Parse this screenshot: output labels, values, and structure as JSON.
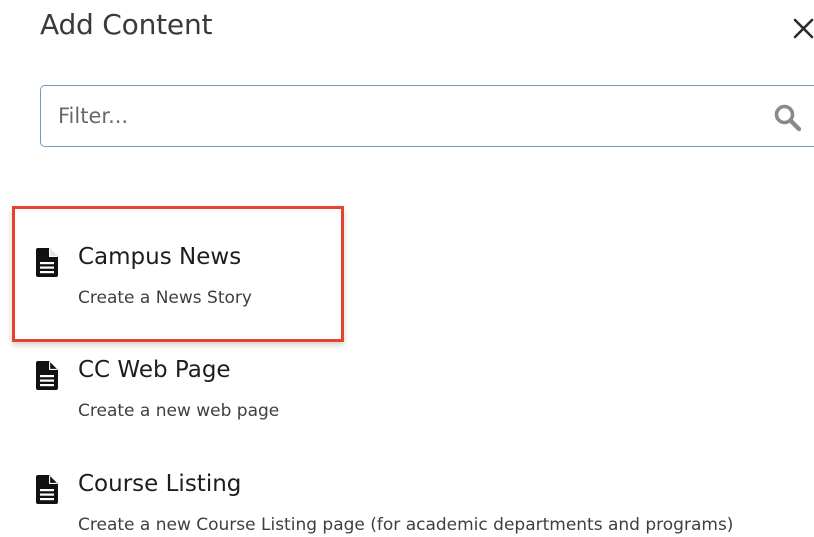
{
  "dialog": {
    "title": "Add Content",
    "close_icon": "close-icon"
  },
  "filter": {
    "placeholder": "Filter...",
    "value": "",
    "icon": "search-icon"
  },
  "items": [
    {
      "name": "Campus News",
      "description": "Create a News Story",
      "icon": "document-icon"
    },
    {
      "name": "CC Web Page",
      "description": "Create a new web page",
      "icon": "document-icon"
    },
    {
      "name": "Course Listing",
      "description": "Create a new Course Listing page (for academic departments and programs)",
      "icon": "document-icon"
    }
  ],
  "highlight": {
    "target": "Campus News",
    "color": "#e8432a"
  }
}
